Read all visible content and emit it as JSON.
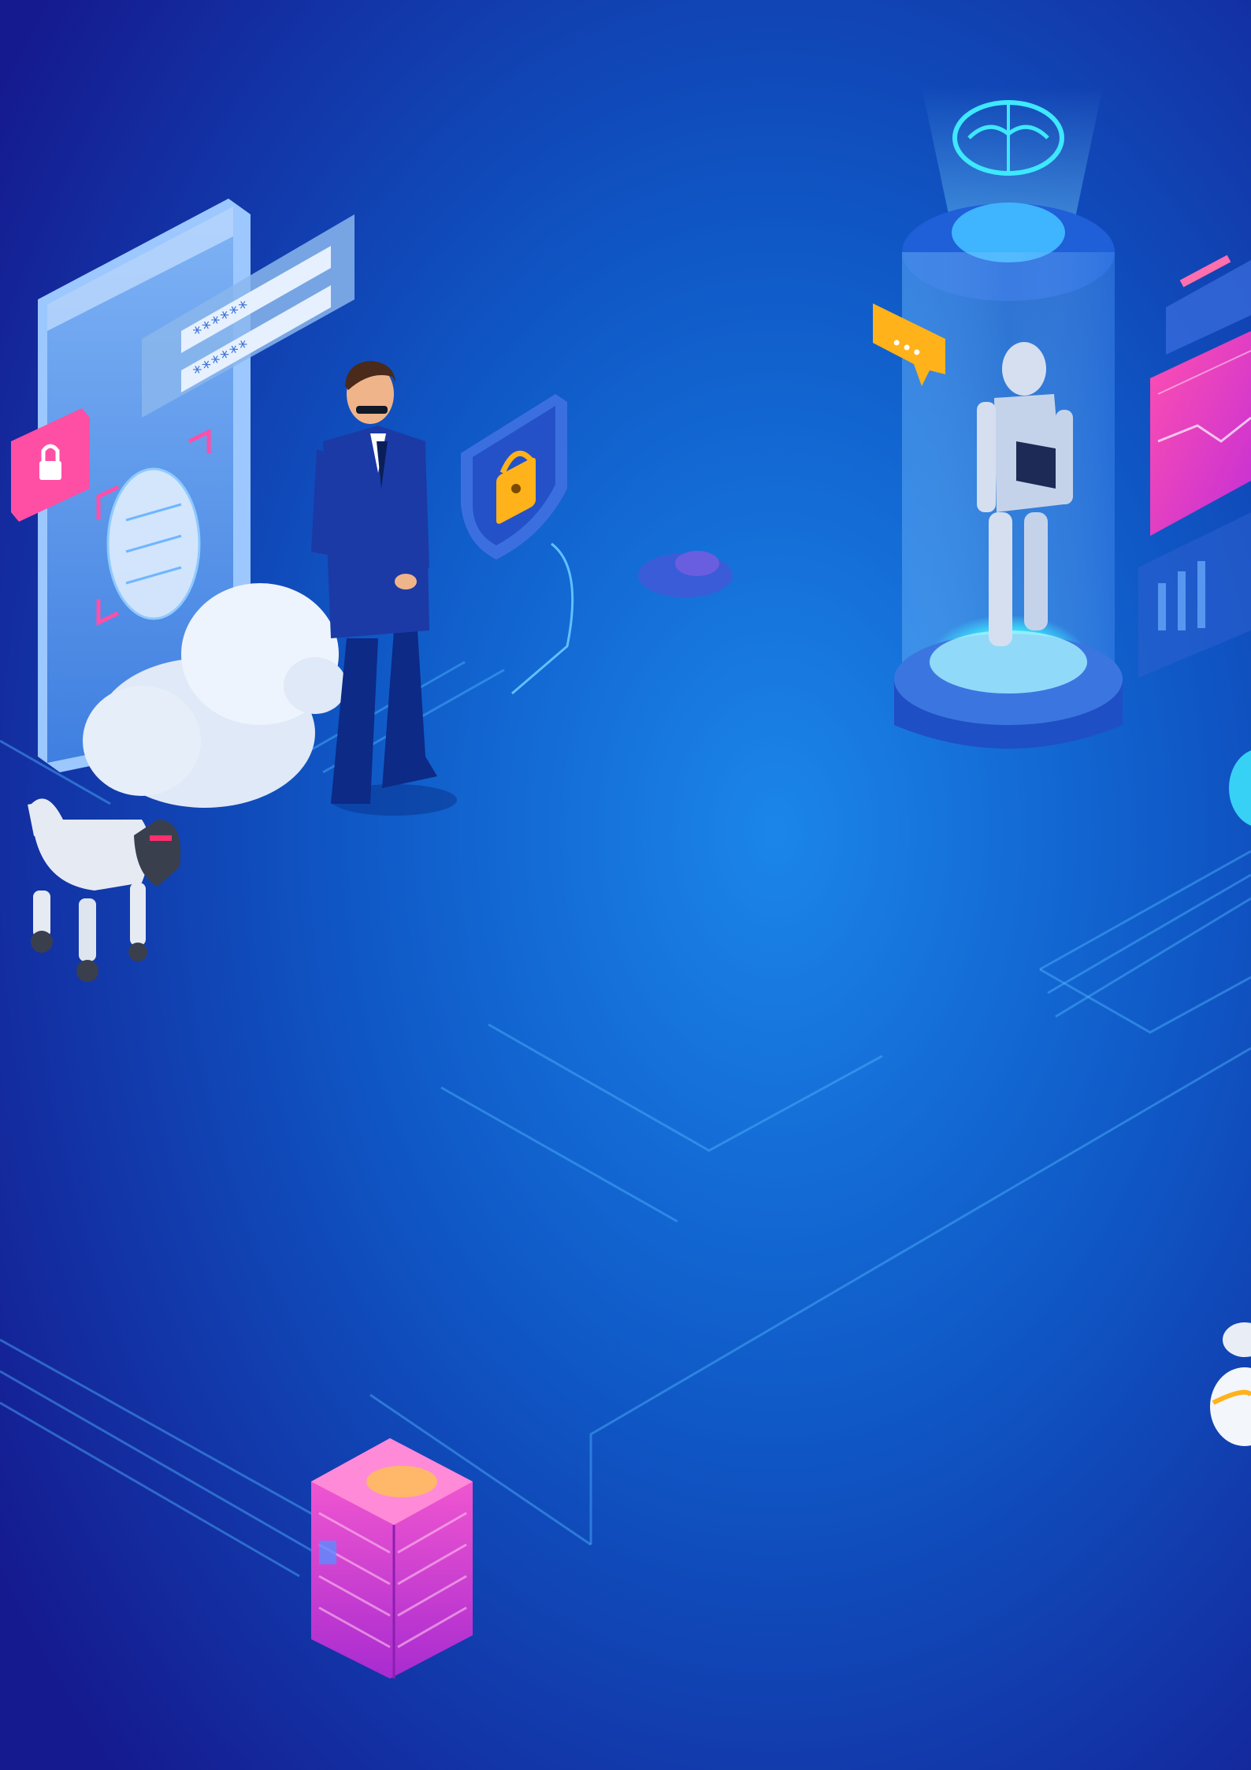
{
  "scene": {
    "description_name": "ai-security-isometric-illustration",
    "palette": {
      "bg_dark": "#15178a",
      "bg_mid": "#0e4fc0",
      "bg_glow": "#1a7ee6",
      "circuit": "#4fb3ff",
      "pink": "#ff3fa4",
      "magenta": "#e13fd0",
      "orange": "#ffb21a",
      "cyan": "#3ee8ff",
      "white": "#e9f1ff"
    },
    "password_mask": "******",
    "password_mask_2": "******",
    "chat_dots": "•••",
    "icons": [
      "phone-face-id-icon",
      "padlock-icon",
      "shield-lock-icon",
      "cloud-icon",
      "brain-hologram-icon",
      "robot-capsule-icon",
      "robot-dog-icon",
      "server-tower-icon",
      "chat-bubble-icon",
      "dashboard-panel-icon",
      "security-agent-icon"
    ]
  }
}
